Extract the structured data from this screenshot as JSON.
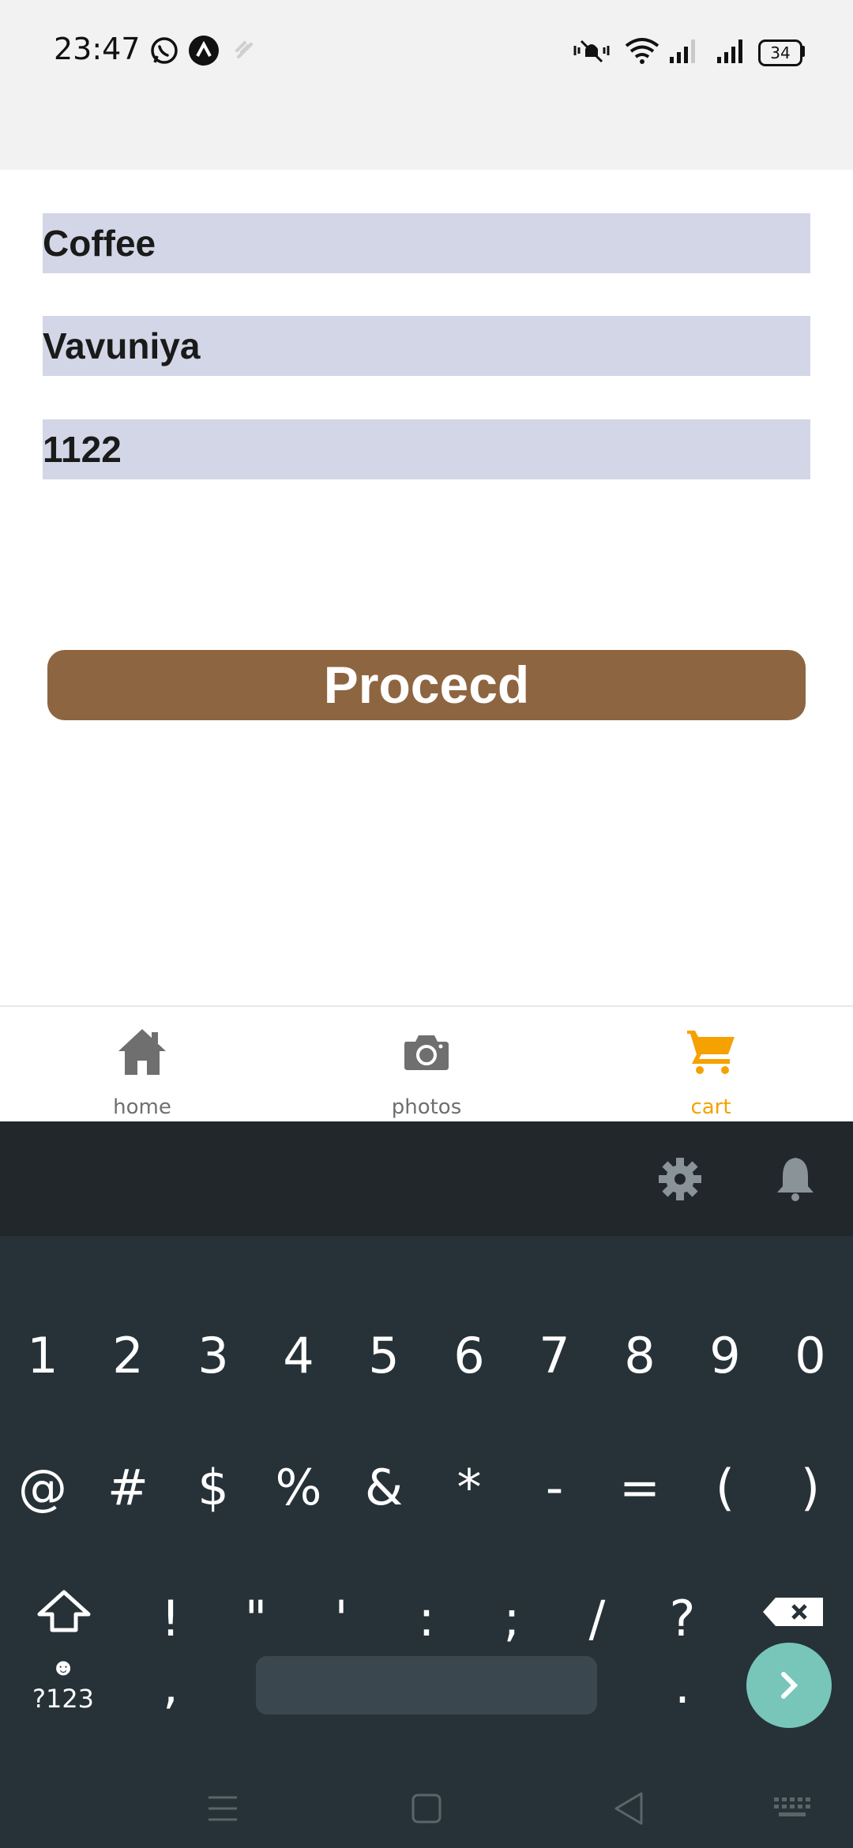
{
  "status_bar": {
    "time": "23:47",
    "battery": "34",
    "icons": [
      "whatsapp-icon",
      "app-icon",
      "sync-icon",
      "mute-icon",
      "wifi-icon",
      "signal-icon",
      "signal-icon",
      "battery-icon"
    ]
  },
  "form": {
    "field_1_value": "Coffee",
    "field_2_value": "Vavuniya",
    "field_3_value": "1122",
    "proceed_label": "Procecd",
    "button_color": "#8e6541",
    "field_color": "#d3d6e6"
  },
  "bottom_nav": {
    "items": [
      {
        "label": "home",
        "icon": "home-icon",
        "active": false
      },
      {
        "label": "photos",
        "icon": "camera-icon",
        "active": false
      },
      {
        "label": "cart",
        "icon": "cart-icon",
        "active": true
      }
    ],
    "active_color": "#f5a100",
    "inactive_color": "#6f6f6f"
  },
  "keyboard": {
    "row_1": [
      "1",
      "2",
      "3",
      "4",
      "5",
      "6",
      "7",
      "8",
      "9",
      "0"
    ],
    "row_2": [
      "@",
      "#",
      "$",
      "%",
      "&",
      "*",
      "-",
      "=",
      "(",
      ")"
    ],
    "row_3": [
      "!",
      "\"",
      "'",
      ":",
      ";",
      "/",
      "?"
    ],
    "row_4_left": "?123",
    "row_4_comma": ",",
    "row_4_period": ".",
    "toolbar_icons": [
      "gear-icon",
      "bell-icon"
    ],
    "enter_color": "#77c6b9"
  }
}
